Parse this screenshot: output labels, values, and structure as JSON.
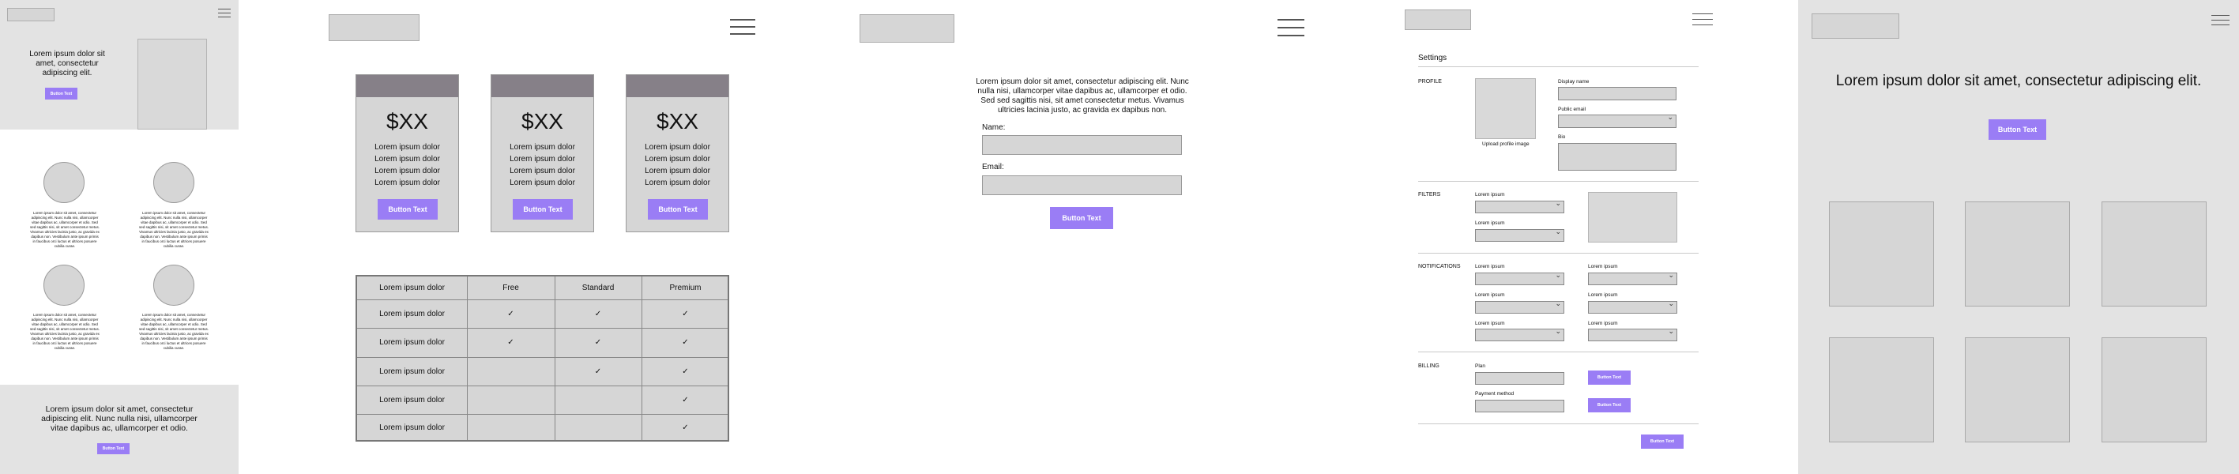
{
  "panel1": {
    "hero_text": "Lorem ipsum dolor sit amet, consectetur adipiscing elit.",
    "hero_button": "Button Text",
    "feature_text": "Lorem ipsum dolor sit amet, consectetur adipiscing elit. Nunc nulla nisi, ullamcorper vitae dapibus ac, ullamcorper et odio. Sed sed sagittis nisi, sit amet consectetur metus. Vivamus ultricies lacinia justo, ac gravida ex dapibus non. Vestibulum ante ipsum primis in faucibus orci luctus et ultrices posuere cubilia curae.",
    "cta_text": "Lorem ipsum dolor sit amet, consectetur adipiscing elit. Nunc nulla nisi, ullamcorper vitae dapibus ac, ullamcorper et odio.",
    "cta_button": "Button Text"
  },
  "panel2": {
    "cards": [
      {
        "price": "$XX",
        "features": [
          "Lorem ipsum dolor",
          "Lorem ipsum dolor",
          "Lorem ipsum dolor",
          "Lorem ipsum dolor"
        ],
        "button": "Button Text"
      },
      {
        "price": "$XX",
        "features": [
          "Lorem ipsum dolor",
          "Lorem ipsum dolor",
          "Lorem ipsum dolor",
          "Lorem ipsum dolor"
        ],
        "button": "Button Text"
      },
      {
        "price": "$XX",
        "features": [
          "Lorem ipsum dolor",
          "Lorem ipsum dolor",
          "Lorem ipsum dolor",
          "Lorem ipsum dolor"
        ],
        "button": "Button Text"
      }
    ],
    "table": {
      "headers": [
        "Lorem ipsum dolor",
        "Free",
        "Standard",
        "Premium"
      ],
      "rows": [
        {
          "label": "Lorem ipsum dolor",
          "checks": [
            true,
            true,
            true
          ]
        },
        {
          "label": "Lorem ipsum dolor",
          "checks": [
            true,
            true,
            true
          ]
        },
        {
          "label": "Lorem ipsum dolor",
          "checks": [
            false,
            true,
            true
          ]
        },
        {
          "label": "Lorem ipsum dolor",
          "checks": [
            false,
            false,
            true
          ]
        },
        {
          "label": "Lorem ipsum dolor",
          "checks": [
            false,
            false,
            true
          ]
        }
      ],
      "check_glyph": "✓"
    }
  },
  "panel3": {
    "intro": "Lorem ipsum dolor sit amet, consectetur adipiscing elit. Nunc nulla nisi, ullamcorper vitae dapibus ac, ullamcorper et odio. Sed sed sagittis nisi, sit amet consectetur metus. Vivamus ultricies lacinia justo, ac gravida ex dapibus non.",
    "name_label": "Name:",
    "email_label": "Email:",
    "button": "Button Text"
  },
  "panel4": {
    "title": "Settings",
    "profile": {
      "section": "PROFILE",
      "upload": "Upload profile image",
      "display_name": "Display name",
      "public_email": "Public email",
      "bio": "Bio"
    },
    "filters": {
      "section": "FILTERS",
      "labels": [
        "Lorem ipsum",
        "Lorem ipsum"
      ]
    },
    "notifications": {
      "section": "NOTIFICATIONS",
      "labels": [
        "Lorem ipsum",
        "Lorem ipsum",
        "Lorem ipsum",
        "Lorem ipsum",
        "Lorem ipsum",
        "Lorem ipsum"
      ]
    },
    "billing": {
      "section": "BILLING",
      "plan": "Plan",
      "payment": "Payment method",
      "button1": "Button Text",
      "button2": "Button Text"
    },
    "save_button": "Button Text"
  },
  "panel5": {
    "headline": "Lorem ipsum dolor sit amet, consectetur adipiscing elit.",
    "button": "Button Text"
  },
  "colors": {
    "accent": "#9a7df5",
    "placeholder": "#d6d6d6",
    "card_header": "#868088",
    "panel_bg": "#e3e3e3"
  }
}
